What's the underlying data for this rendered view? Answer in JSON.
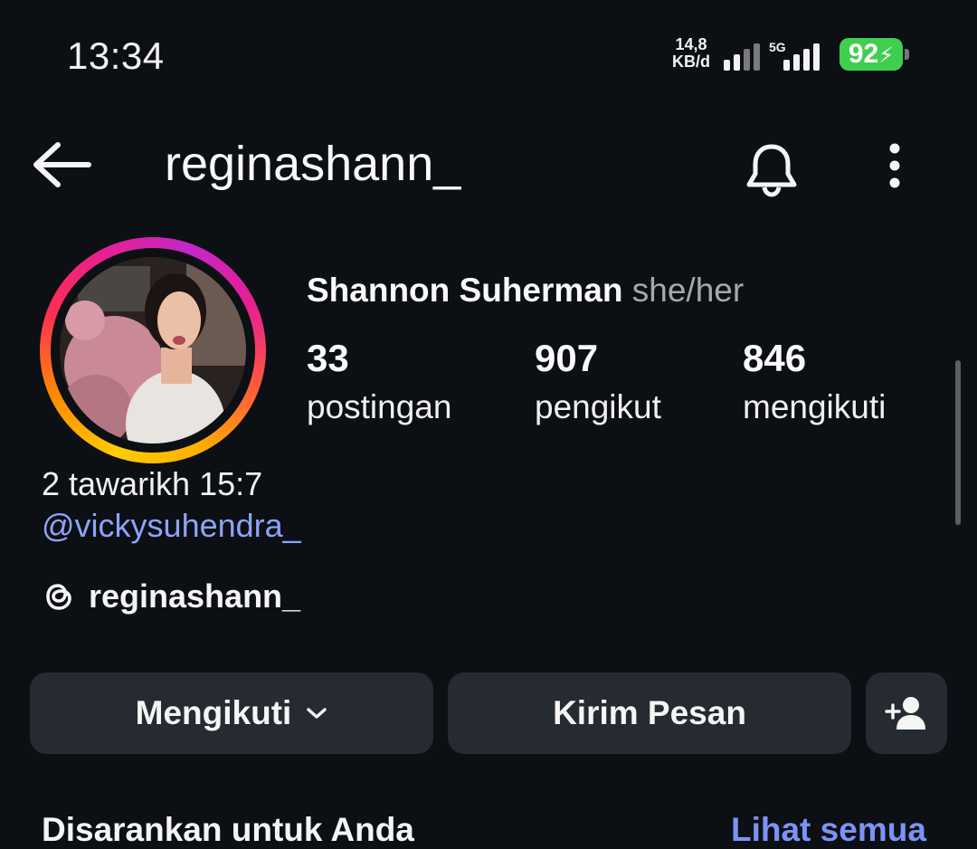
{
  "status_bar": {
    "time": "13:34",
    "speed_value": "14,8",
    "speed_unit": "KB/d",
    "network": "5G",
    "battery": "92",
    "battery_color": "#3fcf4f"
  },
  "header": {
    "back_icon": "arrow-left-icon",
    "username": "reginashann_",
    "bell_icon": "bell-icon",
    "more_icon": "more-vertical-icon"
  },
  "profile": {
    "display_name": "Shannon Suherman",
    "pronouns": "she/her",
    "stats": [
      {
        "value": "33",
        "label": "postingan"
      },
      {
        "value": "907",
        "label": "pengikut"
      },
      {
        "value": "846",
        "label": "mengikuti"
      }
    ],
    "bio": "2 tawarikh 15:7",
    "mention": "@vickysuhendra_",
    "threads_handle": "reginashann_"
  },
  "actions": {
    "follow_label": "Mengikuti",
    "message_label": "Kirim Pesan",
    "add_user_icon": "add-user-icon"
  },
  "suggestions": {
    "title": "Disarankan untuk Anda",
    "see_all": "Lihat semua",
    "link_color": "#7b93f6"
  }
}
